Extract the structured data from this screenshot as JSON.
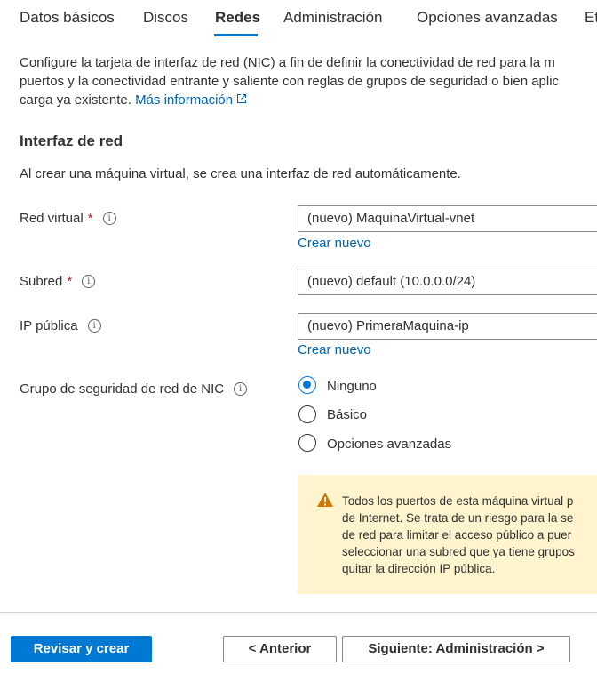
{
  "tabs": [
    {
      "label": "Datos básicos"
    },
    {
      "label": "Discos"
    },
    {
      "label": "Redes"
    },
    {
      "label": "Administración"
    },
    {
      "label": "Opciones avanzadas"
    },
    {
      "label": "Et"
    }
  ],
  "description": {
    "line1": "Configure la tarjeta de interfaz de red (NIC) a fin de definir la conectividad de red para la m",
    "line2": "puertos y la conectividad entrante y saliente con reglas de grupos de seguridad o bien aplic",
    "line3": "carga ya existente.",
    "more_link": "Más información"
  },
  "section": {
    "title": "Interfaz de red",
    "subtitle": "Al crear una máquina virtual, se crea una interfaz de red automáticamente."
  },
  "fields": {
    "vnet": {
      "label": "Red virtual",
      "required": "*",
      "value": "(nuevo) MaquinaVirtual-vnet",
      "create": "Crear nuevo"
    },
    "subnet": {
      "label": "Subred",
      "required": "*",
      "value": "(nuevo) default (10.0.0.0/24)"
    },
    "public_ip": {
      "label": "IP pública",
      "value": "(nuevo) PrimeraMaquina-ip",
      "create": "Crear nuevo"
    },
    "nsg": {
      "label": "Grupo de seguridad de red de NIC",
      "options": [
        "Ninguno",
        "Básico",
        "Opciones avanzadas"
      ],
      "selected": "Ninguno"
    }
  },
  "warning": {
    "lines": [
      "Todos los puertos de esta máquina virtual p",
      "de Internet. Se trata de un riesgo para la se",
      "de red para limitar el acceso público a puer",
      "seleccionar una subred que ya tiene grupos",
      "quitar la dirección IP pública."
    ]
  },
  "footer": {
    "review": "Revisar y crear",
    "previous": "< Anterior",
    "next": "Siguiente: Administración >"
  },
  "colors": {
    "accent": "#0078d4",
    "link": "#0062ad",
    "warning_bg": "#fff4ce",
    "warning_icon": "#d47500",
    "required": "#a4262c"
  }
}
